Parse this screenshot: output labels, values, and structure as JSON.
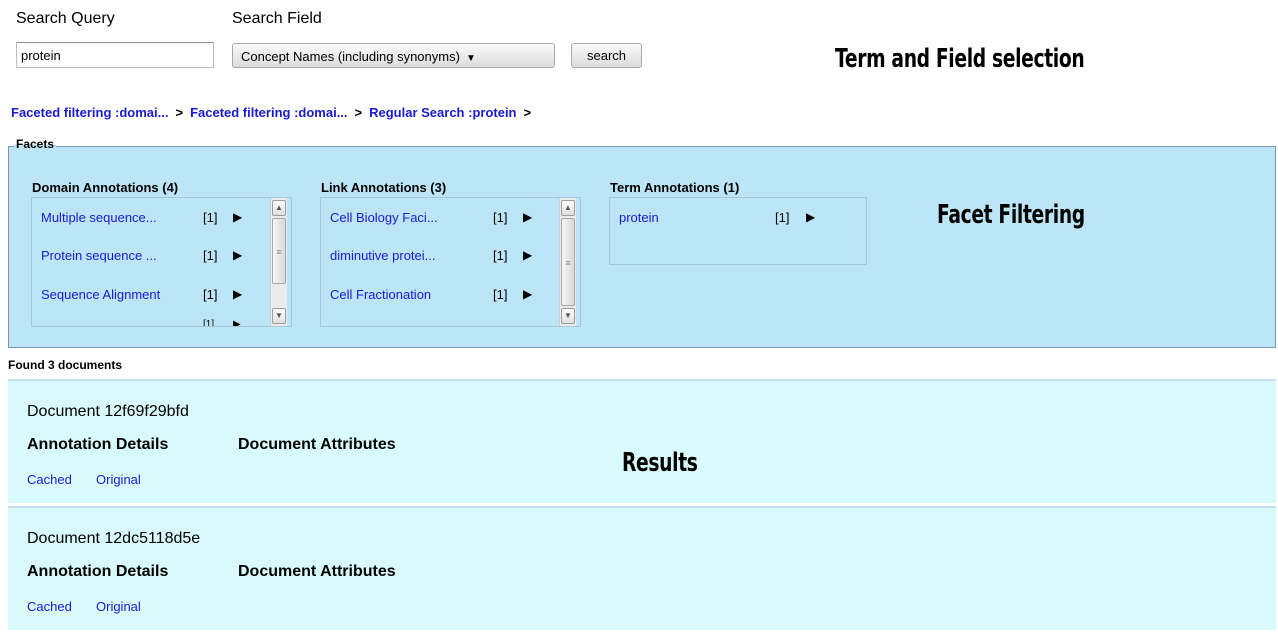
{
  "search": {
    "query_label": "Search Query",
    "field_label": "Search Field",
    "query_value": "protein",
    "field_selected": "Concept Names (including synonyms)",
    "button_label": "search"
  },
  "annotations": {
    "term_field": "Term and Field selection",
    "facet_filtering": "Facet Filtering",
    "results": "Results"
  },
  "breadcrumbs": [
    "Faceted filtering :domai...",
    "Faceted filtering :domai...",
    "Regular Search :protein"
  ],
  "breadcrumb_separator": ">",
  "facets": {
    "legend": "Facets",
    "columns": [
      {
        "title": "Domain Annotations (4)",
        "items": [
          {
            "name": "Multiple sequence...",
            "count": "[1]"
          },
          {
            "name": "Protein sequence ...",
            "count": "[1]"
          },
          {
            "name": "Sequence Alignment",
            "count": "[1]"
          }
        ]
      },
      {
        "title": "Link Annotations (3)",
        "items": [
          {
            "name": "Cell Biology Faci...",
            "count": "[1]"
          },
          {
            "name": "diminutive protei...",
            "count": "[1]"
          },
          {
            "name": "Cell Fractionation",
            "count": "[1]"
          }
        ]
      },
      {
        "title": "Term Annotations (1)",
        "items": [
          {
            "name": "protein",
            "count": "[1]"
          }
        ]
      }
    ],
    "partial_count": "[1]",
    "go_icon": "play-arrow-icon"
  },
  "results": {
    "found_text": "Found 3 documents",
    "documents": [
      {
        "title": "Document 12f69f29bfd",
        "annotation_details": "Annotation Details",
        "document_attributes": "Document Attributes",
        "cached": "Cached",
        "original": "Original"
      },
      {
        "title": "Document 12dc5118d5e",
        "annotation_details": "Annotation Details",
        "document_attributes": "Document Attributes",
        "cached": "Cached",
        "original": "Original"
      }
    ]
  },
  "colors": {
    "link": "#1a1ad4",
    "facet_background": "#bce6f7",
    "result_background": "#d9fafc"
  }
}
